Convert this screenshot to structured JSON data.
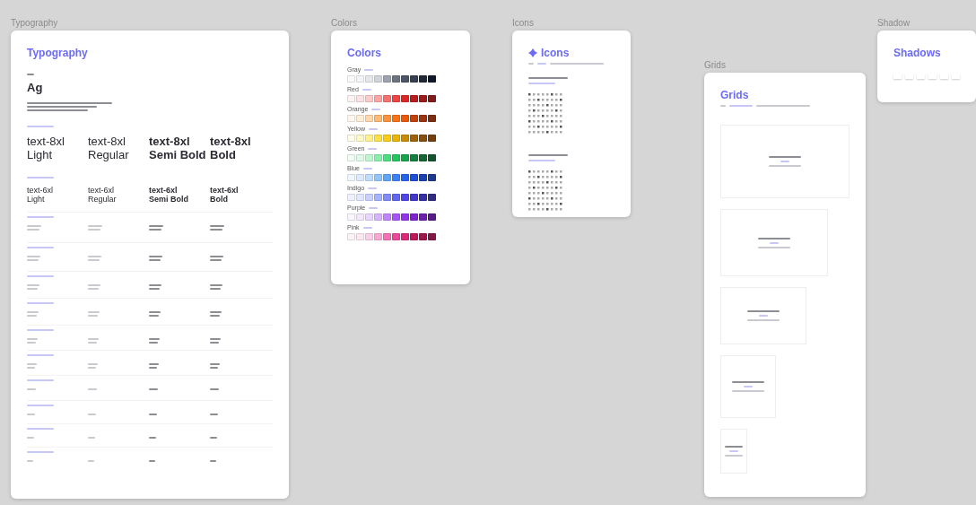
{
  "frames": [
    {
      "kind": "typography",
      "label": "Typography",
      "title": "Typography",
      "specimen": "Ag",
      "samples": [
        {
          "items": [
            {
              "size": "text-8xl",
              "kind": "light",
              "name": "Light"
            },
            {
              "size": "text-8xl",
              "kind": "regular",
              "name": "Regular"
            },
            {
              "size": "text-8xl",
              "kind": "semibold",
              "name": "Semi Bold"
            },
            {
              "size": "text-8xl",
              "kind": "bold",
              "name": "Bold"
            }
          ]
        },
        {
          "items": [
            {
              "size": "text-6xl",
              "kind": "light",
              "name": "Light"
            },
            {
              "size": "text-6xl",
              "kind": "regular",
              "name": "Regular"
            },
            {
              "size": "text-6xl",
              "kind": "semibold",
              "name": "Semi Bold"
            },
            {
              "size": "text-6xl",
              "kind": "bold",
              "name": "Bold"
            }
          ]
        }
      ]
    },
    {
      "kind": "colors",
      "label": "Colors",
      "title": "Colors",
      "palettes": [
        {
          "name": "Gray",
          "swatches": [
            {
              "color": "#f9fafb"
            },
            {
              "color": "#f3f4f6"
            },
            {
              "color": "#e5e7eb"
            },
            {
              "color": "#d1d5db"
            },
            {
              "color": "#9ca3af"
            },
            {
              "color": "#6b7280"
            },
            {
              "color": "#4b5563"
            },
            {
              "color": "#374151"
            },
            {
              "color": "#1f2937"
            },
            {
              "color": "#111827"
            }
          ]
        },
        {
          "name": "Red",
          "swatches": [
            {
              "color": "#fef2f2"
            },
            {
              "color": "#fee2e2"
            },
            {
              "color": "#fecaca"
            },
            {
              "color": "#fca5a5"
            },
            {
              "color": "#f87171"
            },
            {
              "color": "#ef4444"
            },
            {
              "color": "#dc2626"
            },
            {
              "color": "#b91c1c"
            },
            {
              "color": "#991b1b"
            },
            {
              "color": "#7f1d1d"
            }
          ]
        },
        {
          "name": "Orange",
          "swatches": [
            {
              "color": "#fff7ed"
            },
            {
              "color": "#ffedd5"
            },
            {
              "color": "#fed7aa"
            },
            {
              "color": "#fdba74"
            },
            {
              "color": "#fb923c"
            },
            {
              "color": "#f97316"
            },
            {
              "color": "#ea580c"
            },
            {
              "color": "#c2410c"
            },
            {
              "color": "#9a3412"
            },
            {
              "color": "#7c2d12"
            }
          ]
        },
        {
          "name": "Yellow",
          "swatches": [
            {
              "color": "#fefce8"
            },
            {
              "color": "#fef9c3"
            },
            {
              "color": "#fef08a"
            },
            {
              "color": "#fde047"
            },
            {
              "color": "#facc15"
            },
            {
              "color": "#eab308"
            },
            {
              "color": "#ca8a04"
            },
            {
              "color": "#a16207"
            },
            {
              "color": "#854d0e"
            },
            {
              "color": "#713f12"
            }
          ]
        },
        {
          "name": "Green",
          "swatches": [
            {
              "color": "#f0fdf4"
            },
            {
              "color": "#dcfce7"
            },
            {
              "color": "#bbf7d0"
            },
            {
              "color": "#86efac"
            },
            {
              "color": "#4ade80"
            },
            {
              "color": "#22c55e"
            },
            {
              "color": "#16a34a"
            },
            {
              "color": "#15803d"
            },
            {
              "color": "#166534"
            },
            {
              "color": "#14532d"
            }
          ]
        },
        {
          "name": "Blue",
          "swatches": [
            {
              "color": "#eff6ff"
            },
            {
              "color": "#dbeafe"
            },
            {
              "color": "#bfdbfe"
            },
            {
              "color": "#93c5fd"
            },
            {
              "color": "#60a5fa"
            },
            {
              "color": "#3b82f6"
            },
            {
              "color": "#2563eb"
            },
            {
              "color": "#1d4ed8"
            },
            {
              "color": "#1e40af"
            },
            {
              "color": "#1e3a8a"
            }
          ]
        },
        {
          "name": "Indigo",
          "swatches": [
            {
              "color": "#eef2ff"
            },
            {
              "color": "#e0e7ff"
            },
            {
              "color": "#c7d2fe"
            },
            {
              "color": "#a5b4fc"
            },
            {
              "color": "#818cf8"
            },
            {
              "color": "#6366f1"
            },
            {
              "color": "#4f46e5"
            },
            {
              "color": "#4338ca"
            },
            {
              "color": "#3730a3"
            },
            {
              "color": "#312e81"
            }
          ]
        },
        {
          "name": "Purple",
          "swatches": [
            {
              "color": "#faf5ff"
            },
            {
              "color": "#f3e8ff"
            },
            {
              "color": "#e9d5ff"
            },
            {
              "color": "#d8b4fe"
            },
            {
              "color": "#c084fc"
            },
            {
              "color": "#a855f7"
            },
            {
              "color": "#9333ea"
            },
            {
              "color": "#7e22ce"
            },
            {
              "color": "#6b21a8"
            },
            {
              "color": "#581c87"
            }
          ]
        },
        {
          "name": "Pink",
          "swatches": [
            {
              "color": "#fdf2f8"
            },
            {
              "color": "#fce7f3"
            },
            {
              "color": "#fbcfe8"
            },
            {
              "color": "#f9a8d4"
            },
            {
              "color": "#f472b6"
            },
            {
              "color": "#ec4899"
            },
            {
              "color": "#db2777"
            },
            {
              "color": "#be185d"
            },
            {
              "color": "#9d174d"
            },
            {
              "color": "#831843"
            }
          ]
        }
      ]
    },
    {
      "kind": "icons",
      "label": "Icons",
      "title": "Icons"
    },
    {
      "kind": "grids",
      "label": "Grids",
      "title": "Grids"
    },
    {
      "kind": "shadows",
      "label": "Shadow",
      "title": "Shadows"
    }
  ]
}
